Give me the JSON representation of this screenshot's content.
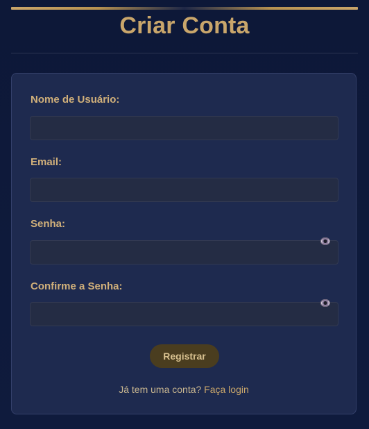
{
  "header": {
    "title": "Criar Conta"
  },
  "form": {
    "fields": [
      {
        "label": "Nome de Usuário:",
        "value": ""
      },
      {
        "label": "Email:",
        "value": ""
      },
      {
        "label": "Senha:",
        "value": "",
        "toggle_icon": "eye-icon"
      },
      {
        "label": "Confirme a Senha:",
        "value": "",
        "toggle_icon": "eye-icon"
      }
    ],
    "submit_label": "Registrar"
  },
  "footer": {
    "prompt": "Já tem uma conta?",
    "link_label": "Faça login"
  },
  "colors": {
    "background": "#0f1a3a",
    "card": "#1e2a4f",
    "accent": "#c9a66b",
    "button": "#4a3d1f"
  }
}
